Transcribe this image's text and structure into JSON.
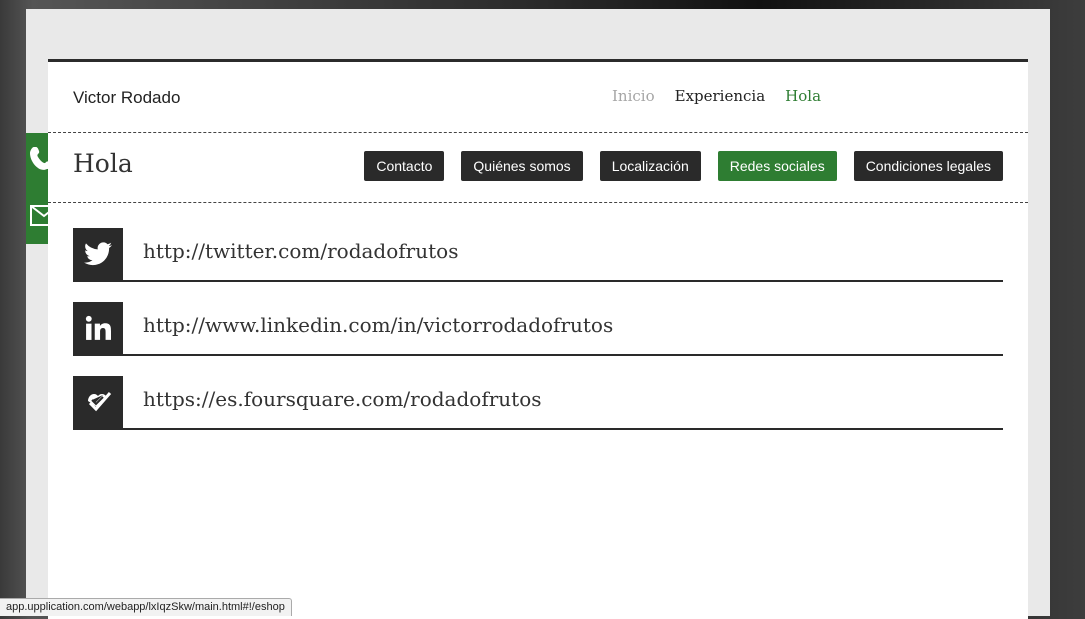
{
  "header": {
    "brand": "Victor Rodado"
  },
  "nav": {
    "items": [
      "Inicio",
      "Experiencia",
      "Hola"
    ]
  },
  "section": {
    "title": "Hola"
  },
  "tabs": [
    "Contacto",
    "Quiénes somos",
    "Localización",
    "Redes sociales",
    "Condiciones legales"
  ],
  "social": {
    "twitter": "http://twitter.com/rodadofrutos",
    "linkedin": "http://www.linkedin.com/in/victorrodadofrutos",
    "foursquare": "https://es.foursquare.com/rodadofrutos"
  },
  "side_buttons": {
    "icons": [
      "phone-icon",
      "mail-icon"
    ]
  },
  "status_bar": {
    "url": "app.upplication.com/webapp/lxIqzSkw/main.html#!/eshop"
  },
  "colors": {
    "accent": "#2e7d32",
    "dark": "#2a2a2a",
    "muted": "#a6a6a6"
  }
}
